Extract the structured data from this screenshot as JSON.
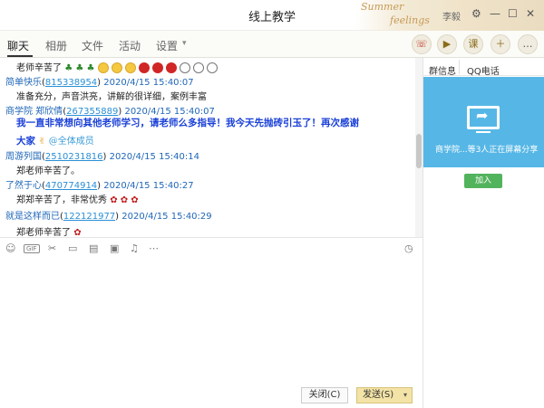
{
  "window": {
    "title": "线上教学",
    "decoration_text_1": "Summer",
    "decoration_text_2": "feelings",
    "user_label": "李毅",
    "controls": [
      "⚙",
      "—",
      "☐",
      "✕"
    ]
  },
  "tabs": [
    {
      "label": "聊天"
    },
    {
      "label": "相册"
    },
    {
      "label": "文件"
    },
    {
      "label": "活动"
    },
    {
      "label": "设置"
    }
  ],
  "top_actions": [
    {
      "icon": "phone-icon",
      "glyph": "☏"
    },
    {
      "icon": "video-icon",
      "glyph": "▶"
    },
    {
      "icon": "lesson-icon",
      "glyph": "课"
    },
    {
      "icon": "add-app-icon",
      "glyph": "＋"
    },
    {
      "icon": "more-icon",
      "glyph": "…"
    }
  ],
  "messages": [
    {
      "name": "",
      "qq": "",
      "time": "",
      "text": "老师辛苦了"
    },
    {
      "name": "简单快乐",
      "qq": "815338954",
      "time": "2020/4/15 15:40:07",
      "text": "准备充分，声音洪亮，讲解的很详细，案例丰富"
    },
    {
      "name": "商学院 郑欣倩",
      "qq": "267355889",
      "time": "2020/4/15 15:40:07",
      "text_line1": "我一直非常想向其他老师学习，请老师么多指导！我今天先抛砖引玉了！再次感谢",
      "text_line2": "大家",
      "mention": "@全体成员"
    },
    {
      "name": "周游列国",
      "qq": "2510231816",
      "time": "2020/4/15 15:40:14",
      "text": "郑老师辛苦了。"
    },
    {
      "name": "了然于心",
      "qq": "470774914",
      "time": "2020/4/15 15:40:27",
      "text": "郑郑辛苦了，非常优秀"
    },
    {
      "name": "就是这样而已",
      "qq": "122121977",
      "time": "2020/4/15 15:40:29",
      "text": "郑老师辛苦了"
    }
  ],
  "toolbar": {
    "items": [
      "emoji-icon",
      "gif-icon",
      "scissors-icon",
      "folder-icon",
      "file-icon",
      "image-icon",
      "bell-icon",
      "more-icon",
      "history-icon"
    ],
    "gif_label": "GIF"
  },
  "buttons": {
    "close_label": "关闭(C)",
    "send_label": "发送(S)"
  },
  "right_panel": {
    "tabs": [
      "群信息",
      "QQ电话"
    ],
    "share_text": "商学院...等3人正在屏幕分享",
    "join_label": "加入",
    "share_color": "#56b7e6",
    "join_color": "#52b35d"
  }
}
